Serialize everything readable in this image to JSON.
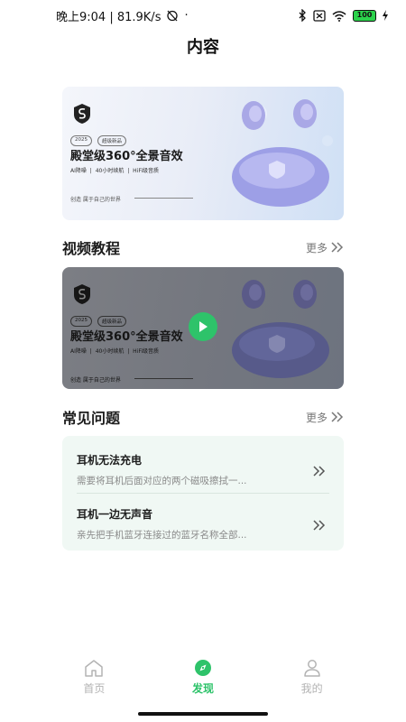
{
  "status_bar": {
    "time_speed": "晚上9:04 | 81.9K/s",
    "battery": "100",
    "dot": "·"
  },
  "header": {
    "title": "内容"
  },
  "banner": {
    "year_tag": "2025",
    "new_tag": "超级新品",
    "headline": "殿堂级360°全景音效",
    "features": "AI降噪 | 40小时续航 | HiFi级音质",
    "slogan": "创造 属于自己的世界"
  },
  "video_section": {
    "title": "视频教程",
    "more": "更多",
    "card": {
      "year_tag": "2025",
      "new_tag": "超级新品",
      "headline": "殿堂级360°全景音效",
      "features": "AI降噪 | 40小时续航 | HiFi级音质",
      "slogan": "创造 属于自己的世界"
    }
  },
  "faq_section": {
    "title": "常见问题",
    "more": "更多",
    "items": [
      {
        "question": "耳机无法充电",
        "answer": "需要将耳机后面对应的两个磁吸擦拭一..."
      },
      {
        "question": "耳机一边无声音",
        "answer": "亲先把手机蓝牙连接过的蓝牙名称全部..."
      }
    ]
  },
  "bottom_nav": {
    "items": [
      {
        "label": "首页",
        "icon": "home-icon"
      },
      {
        "label": "发现",
        "icon": "compass-icon"
      },
      {
        "label": "我的",
        "icon": "profile-icon"
      }
    ],
    "active_index": 1,
    "accent_color": "#2ec36a",
    "inactive_color": "#b3b3b3"
  }
}
